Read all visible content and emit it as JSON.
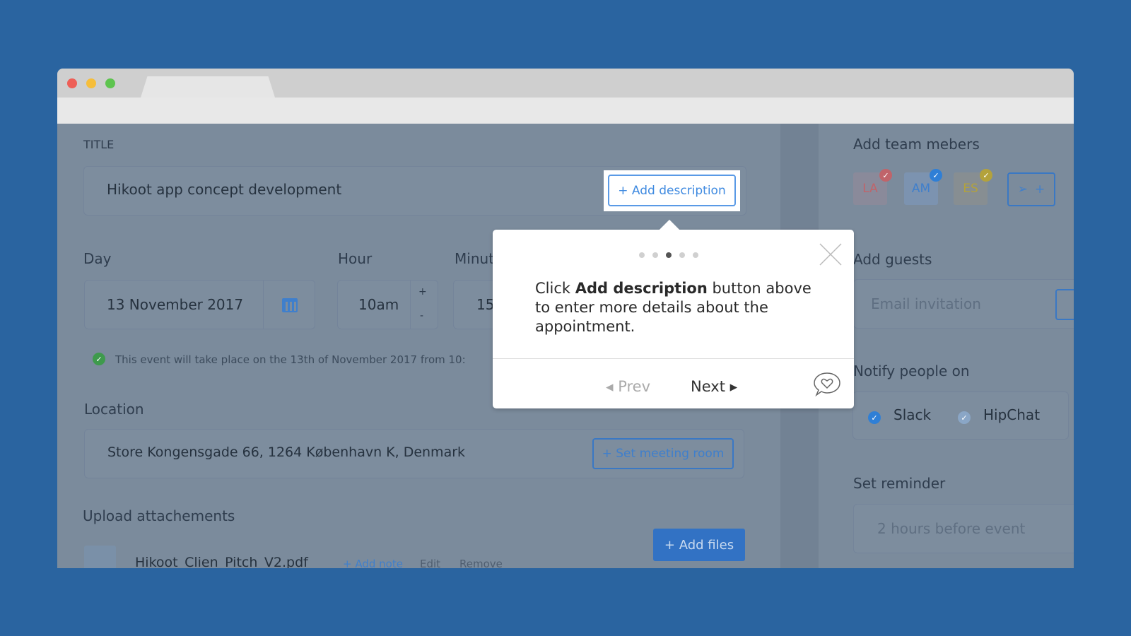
{
  "colors": {
    "background": "#2a64a0",
    "accent": "#3a78c4",
    "la": "#d9534f",
    "am": "#2f7fd6",
    "es": "#c9a916"
  },
  "form": {
    "title_label": "TITLE",
    "title_value": "Hikoot app concept development",
    "add_description": "+ Add description",
    "day_label": "Day",
    "day_value": "13 November 2017",
    "hour_label": "Hour",
    "hour_value": "10am",
    "hour_plus": "+",
    "hour_minus": "-",
    "minute_label": "Minut",
    "minute_value": "15",
    "info": "This event will take place on the 13th of November 2017 from 10:",
    "location_label": "Location",
    "location_value": "Store Kongensgade 66, 1264 København K, Denmark",
    "set_meeting_room": "+ Set meeting room",
    "upload_label": "Upload attachements",
    "add_files": "+ Add files",
    "attachment": {
      "name": "Hikoot_Clien_Pitch_V2.pdf",
      "add_note": "+ Add note",
      "edit": "Edit",
      "remove": "Remove"
    }
  },
  "side": {
    "team_label": "Add team mebers",
    "members": [
      "LA",
      "AM",
      "ES"
    ],
    "invite_plus": "+",
    "guests_label": "Add guests",
    "guests_placeholder": "Email invitation",
    "notify_label": "Notify people on",
    "notify": [
      {
        "label": "Slack",
        "checked": true
      },
      {
        "label": "HipChat",
        "checked": false
      }
    ],
    "reminder_label": "Set reminder",
    "reminder_value": "2 hours before event"
  },
  "tour": {
    "step": 3,
    "steps": 5,
    "text_pre": "Click ",
    "text_bold": "Add description",
    "text_post": " button above to enter more details about the appointment.",
    "prev": "Prev",
    "next": "Next"
  }
}
